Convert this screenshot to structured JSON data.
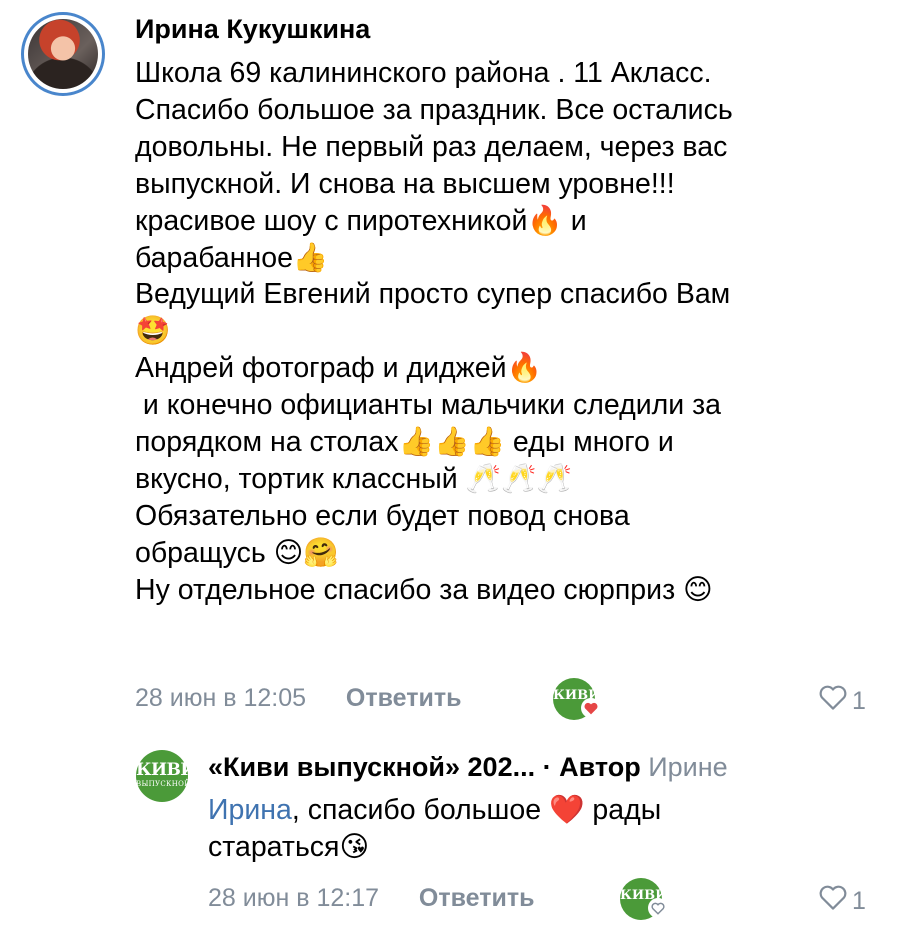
{
  "comment": {
    "author": "Ирина Кукушкина",
    "text": "Школа 69 калининского района . 11 Акласс.\nСпасибо большое за праздник. Все остались\nдовольны. Не первый раз делаем, через вас\nвыпускной. И снова на высшем уровне!!!\nкрасивое шоу с пиротехникой🔥 и\nбарабанное👍\nВедущий Евгений просто супер спасибо Вам\n🤩\nАндрей фотограф и диджей🔥\n и конечно официанты мальчики следили за\nпорядком на столах👍👍👍 еды много и\nвкусно, тортик классный 🥂🥂🥂\nОбязательно если будет повод снова\nобращусь 😊🤗\nНу отдельное спасибо за видео сюрприз 😊",
    "date": "28 июн в 12:05",
    "reply_label": "Ответить",
    "likes": "1"
  },
  "reply": {
    "author": "«Киви выпускной» 202...",
    "author_badge": " · Автор",
    "addressee": " Ирине",
    "mention": "Ирина",
    "text": ", спасибо большое ❤️ рады\nстараться😘",
    "date": "28 июн в 12:17",
    "reply_label": "Ответить",
    "likes": "1"
  },
  "kivi_logo": {
    "line1": "КИВИ",
    "line2": "ВЫПУСКНОЙ"
  },
  "colors": {
    "accent": "#4986cc",
    "muted": "#818c99",
    "brand_green": "#4b9a39",
    "heart": "#e64646"
  }
}
